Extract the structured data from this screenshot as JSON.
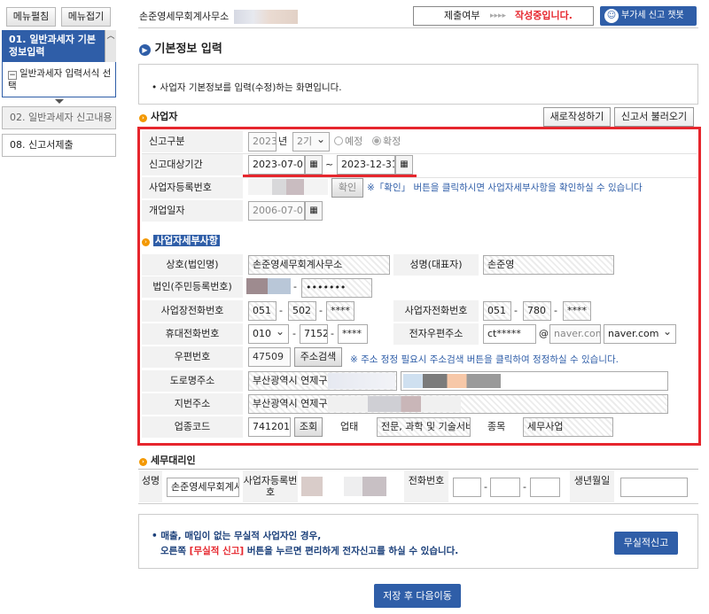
{
  "sidebar": {
    "expand_label": "메뉴펼침",
    "collapse_label": "메뉴접기",
    "active_item": "01. 일반과세자 기본정보입력",
    "sub_item": "일반과세자 입력서식 선택",
    "item2": "02. 일반과세자 신고내용",
    "item3": "08. 신고서제출"
  },
  "header": {
    "office_name": "손준영세무회계사무소",
    "status_label": "제출여부",
    "status_arrows": "▸▸▸▸",
    "status_value": "작성중입니다.",
    "chatbot_label": "부가세 신고 챗봇"
  },
  "page": {
    "title": "기본정보 입력",
    "info_text": "• 사업자 기본정보를 입력(수정)하는 화면입니다.",
    "section_business": "사업자",
    "new_button": "새로작성하기",
    "load_button": "신고서 불러오기"
  },
  "form": {
    "report_type_label": "신고구분",
    "year": "2023",
    "year_suffix": "년",
    "period": "2기",
    "radio_preliminary": "예정",
    "radio_final": "확정",
    "period_label": "신고대상기간",
    "start_date": "2023-07-01",
    "tilde": "~",
    "end_date": "2023-12-31",
    "reg_no_label": "사업자등록번호",
    "confirm_button": "확인",
    "reg_note": "※「확인」 버튼을 클릭하시면 사업자세부사항을 확인하실 수 있습니다",
    "open_date_label": "개업일자",
    "open_date": "2006-07-01",
    "detail_section": "사업자세부사항",
    "company_label": "상호(법인명)",
    "company_value": "손준영세무회계사무소",
    "rep_label": "성명(대표자)",
    "rep_value": "손준영",
    "corp_no_label": "법인(주민등록번호)",
    "corp_no_tail": "•••••••",
    "dash": "-",
    "biz_phone_label": "사업장전화번호",
    "biz_phone1": "051",
    "biz_phone2": "502",
    "biz_phone3": "****",
    "op_phone_label": "사업자전화번호",
    "op_phone1": "051",
    "op_phone2": "780",
    "op_phone3": "****",
    "mobile_label": "휴대전화번호",
    "mobile1": "010",
    "mobile2": "7152",
    "mobile3": "****",
    "email_label": "전자우편주소",
    "email_id": "ct*****",
    "at": "@",
    "email_domain": "naver.com",
    "email_select": "naver.com",
    "zip_label": "우편번호",
    "zip_value": "47509",
    "zip_button": "주소검색",
    "zip_note": "※ 주소 정정 필요시 주소검색 버튼을 클릭하여 정정하실 수 있습니다.",
    "road_label": "도로명주소",
    "road_value": "부산광역시 연제구",
    "lot_label": "지번주소",
    "lot_value": "부산광역시 연제구",
    "industry_label": "업종코드",
    "industry_code": "741201",
    "lookup_button": "조회",
    "biz_type_label": "업태",
    "biz_type_value": "전문, 과학 및 기술서비",
    "item_label": "종목",
    "item_value": "세무사업"
  },
  "agent": {
    "section": "세무대리인",
    "name_label": "성명",
    "name_value": "손준영세무회계사",
    "reg_label": "사업자등록번호",
    "phone_label": "전화번호",
    "dob_label": "생년월일"
  },
  "notice": {
    "line1": "• 매출, 매입이 없는 무실적 사업자인 경우,",
    "line2_a": "오른쪽 ",
    "line2_b": "[무실적 신고]",
    "line2_c": " 버튼을 누르면 편리하게 전자신고를 하실 수 있습니다.",
    "button": "무실적신고"
  },
  "footer": {
    "save_button": "저장 후 다음이동"
  },
  "colors": {
    "primary": "#2f5ea8",
    "highlight_red": "#e6262d",
    "bullet_orange": "#f39800"
  }
}
